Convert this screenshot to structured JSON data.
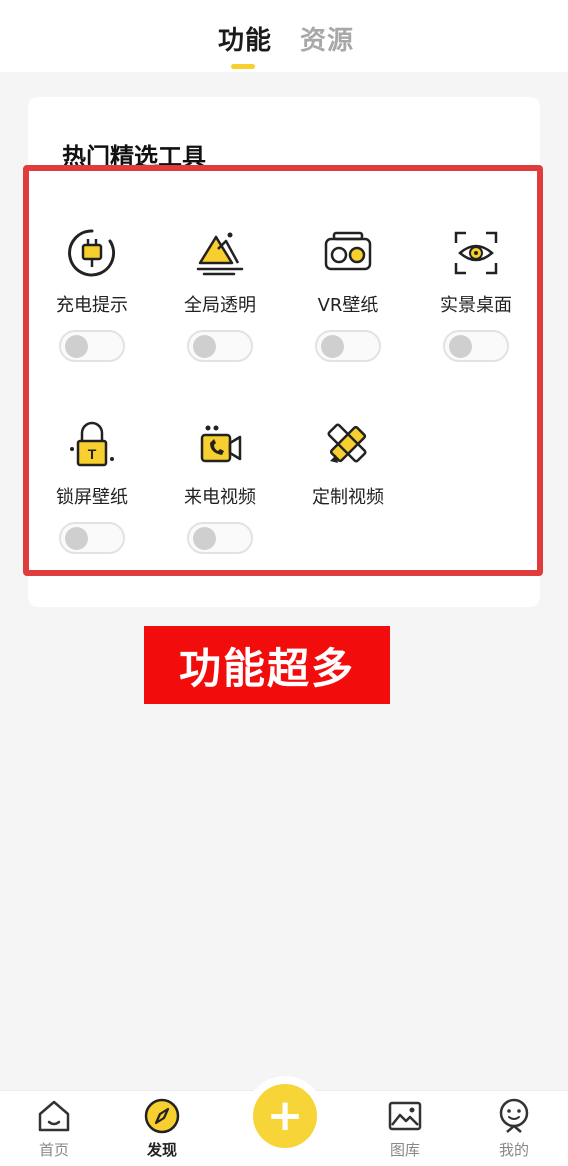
{
  "header": {
    "tabs": [
      {
        "label": "功能",
        "active": true
      },
      {
        "label": "资源",
        "active": false
      }
    ]
  },
  "section": {
    "title": "热门精选工具",
    "tools": [
      {
        "label": "充电提示",
        "icon": "charging-plug-icon",
        "enabled": false
      },
      {
        "label": "全局透明",
        "icon": "mountain-landscape-icon",
        "enabled": false
      },
      {
        "label": "VR壁纸",
        "icon": "vr-glasses-icon",
        "enabled": false
      },
      {
        "label": "实景桌面",
        "icon": "eye-scan-icon",
        "enabled": false
      },
      {
        "label": "锁屏壁纸",
        "icon": "lock-icon",
        "enabled": false
      },
      {
        "label": "来电视频",
        "icon": "video-call-icon",
        "enabled": false
      },
      {
        "label": "定制视频",
        "icon": "pencil-edit-icon"
      }
    ]
  },
  "promo": {
    "text": "功能超多"
  },
  "bottom_nav": {
    "items": [
      {
        "label": "首页",
        "icon": "home-icon",
        "active": false
      },
      {
        "label": "发现",
        "icon": "compass-icon",
        "active": true
      },
      {
        "label": "图库",
        "icon": "gallery-icon",
        "active": false
      },
      {
        "label": "我的",
        "icon": "profile-icon",
        "active": false
      }
    ],
    "fab": {
      "symbol": "+",
      "icon": "add-icon"
    }
  },
  "colors": {
    "accent": "#f7cf2e",
    "highlight_border": "#e03c3c",
    "promo_bg": "#f20c0c"
  }
}
